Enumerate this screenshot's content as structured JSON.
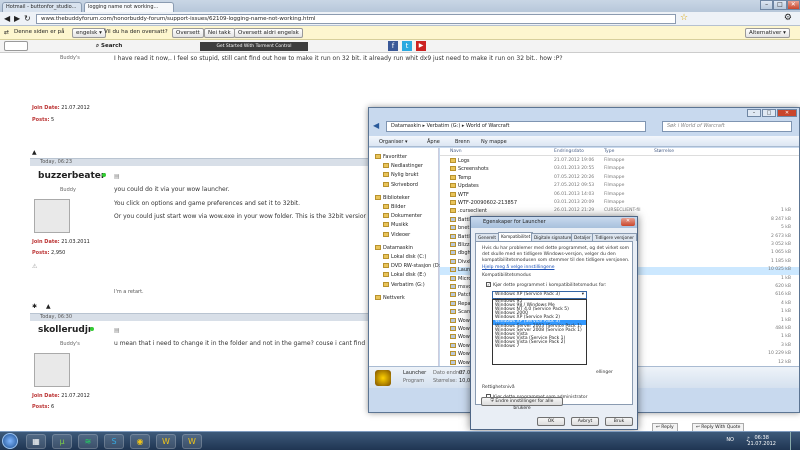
{
  "browser": {
    "tabs": [
      "Hotmail - buttonfor_studio...",
      "logging name not working..."
    ],
    "url": "www.thebuddyforum.com/honorbuddy-forum/support-issues/62109-logging-name-not-working.html",
    "translate": {
      "prefix": "Denne siden er på",
      "from_lang": "engelsk",
      "question": "Vil du ha den oversatt?",
      "translate_btn": "Oversett",
      "no_btn": "Nei takk",
      "never_btn": "Oversett aldri engelsk",
      "options_btn": "Alternativer"
    },
    "search_btn": "Search",
    "toolbar_title": "Get Started With Torment Control"
  },
  "forum": {
    "post1": {
      "role": "Buddy's",
      "text": "I have read it now,. I feel so stupid, still cant find out how to make it run on 32 bit. it already run whit dx9 just need to make it run on 32 bit.. how :P?",
      "join_label": "Join Date:",
      "join_date": "21.07.2012",
      "posts_label": "Posts:",
      "posts": "5"
    },
    "post2": {
      "date": "Today, 06:23",
      "user": "buzzerbeater",
      "role": "Buddy",
      "line1": "you could do it via your wow launcher.",
      "line2": "You click on options and game preferences and set it to 32bit.",
      "line3": "Or you could just start wow via wow.exe in your wow folder. This is the 32bit version. The",
      "sig": "I'm a retart.",
      "join_label": "Join Date:",
      "join_date": "21.03.2011",
      "posts_label": "Posts:",
      "posts": "2,950"
    },
    "post3": {
      "date": "Today, 06:30",
      "user": "skollerudjr",
      "role": "Buddy's",
      "line1": "u mean that i need to change it in the folder and not in the game? couse i cant find 32bit a",
      "join_label": "Join Date:",
      "join_date": "21.07.2012",
      "posts_label": "Posts:",
      "posts": "6",
      "reply": "Reply",
      "reply_quote": "Reply With Quote"
    }
  },
  "explorer": {
    "path": [
      "Datamaskin",
      "Verbatim (G:)",
      "World of Warcraft"
    ],
    "search_placeholder": "Søk i World of Warcraft",
    "cmd": {
      "organize": "Organiser",
      "open": "Åpne",
      "burn": "Brenn",
      "new_folder": "Ny mappe"
    },
    "columns": {
      "name": "Navn",
      "date": "Endringsdato",
      "type": "Type",
      "size": "Størrelse"
    },
    "nav": [
      {
        "label": "Favoritter",
        "indent": 0
      },
      {
        "label": "Nedlastinger",
        "indent": 1
      },
      {
        "label": "Nylig brukt",
        "indent": 1
      },
      {
        "label": "Skrivebord",
        "indent": 1
      },
      {
        "label": "Biblioteker",
        "indent": 0
      },
      {
        "label": "Bilder",
        "indent": 1
      },
      {
        "label": "Dokumenter",
        "indent": 1
      },
      {
        "label": "Musikk",
        "indent": 1
      },
      {
        "label": "Videoer",
        "indent": 1
      },
      {
        "label": "Datamaskin",
        "indent": 0
      },
      {
        "label": "Lokal disk (C:)",
        "indent": 1
      },
      {
        "label": "DVD RW-stasjon (D:)",
        "indent": 1
      },
      {
        "label": "Lokal disk (E:)",
        "indent": 1
      },
      {
        "label": "Verbatim (G:)",
        "indent": 1
      },
      {
        "label": "Nettverk",
        "indent": 0
      }
    ],
    "files": [
      {
        "name": "Logs",
        "date": "21.07.2012 19:06",
        "type": "Filmappe",
        "size": ""
      },
      {
        "name": "Screenshots",
        "date": "03.01.2013 20:55",
        "type": "Filmappe",
        "size": ""
      },
      {
        "name": "Temp",
        "date": "07.05.2012 20:26",
        "type": "Filmappe",
        "size": ""
      },
      {
        "name": "Updates",
        "date": "27.05.2012 09:53",
        "type": "Filmappe",
        "size": ""
      },
      {
        "name": "WTF",
        "date": "06.01.2013 14:03",
        "type": "Filmappe",
        "size": ""
      },
      {
        "name": "WTF-20090602-213857",
        "date": "03.01.2013 20:09",
        "type": "Filmappe",
        "size": ""
      },
      {
        "name": ".curseclient",
        "date": "26.01.2012 21:29",
        "type": "CURSECLIENT-fil",
        "size": "1 kB"
      },
      {
        "name": "Battle.net.dll",
        "date": "",
        "type": "",
        "size": "8 247 kB"
      },
      {
        "name": "bnet.gdb",
        "date": "",
        "type": "",
        "size": "5 kB"
      },
      {
        "name": "Battle.net.mpq",
        "date": "",
        "type": "",
        "size": "2 673 kB"
      },
      {
        "name": "Blizzard Launcher",
        "date": "",
        "type": "",
        "size": "3 052 kB"
      },
      {
        "name": "dbghelp.dll",
        "date": "",
        "type": "",
        "size": "1 065 kB"
      },
      {
        "name": "DivxDecoder.dll",
        "date": "",
        "type": "",
        "size": "1 185 kB"
      },
      {
        "name": "Launcher",
        "date": "",
        "type": "",
        "size": "10 025 kB"
      },
      {
        "name": "Microsoft.VC80.CRT",
        "date": "",
        "type": "",
        "size": "1 kB"
      },
      {
        "name": "msvcr80.dll",
        "date": "",
        "type": "",
        "size": "620 kB"
      },
      {
        "name": "Patch",
        "date": "",
        "type": "",
        "size": "616 kB"
      },
      {
        "name": "Repair",
        "date": "",
        "type": "",
        "size": "4 kB"
      },
      {
        "name": "Scan.dll",
        "date": "",
        "type": "",
        "size": "1 kB"
      },
      {
        "name": "Wow",
        "date": "",
        "type": "",
        "size": "1 kB"
      },
      {
        "name": "Wow",
        "date": "",
        "type": "",
        "size": "484 kB"
      },
      {
        "name": "Wow-64",
        "date": "",
        "type": "",
        "size": "1 kB"
      },
      {
        "name": "Wow",
        "date": "",
        "type": "",
        "size": "3 kB"
      },
      {
        "name": "Wow",
        "date": "",
        "type": "",
        "size": "10 229 kB"
      },
      {
        "name": "WowError",
        "date": "",
        "type": "",
        "size": "12 kB"
      }
    ],
    "details": {
      "name": "Launcher",
      "type": "Program",
      "date_label": "Dato endret:",
      "date": "07.05",
      "size_label": "Størrelse:",
      "size": "10,0 M"
    }
  },
  "dialog": {
    "title": "Egenskaper for Launcher",
    "tabs": [
      "Generelt",
      "Kompatibilitet",
      "Digitale signaturer",
      "Detaljer",
      "Tidligere versjoner"
    ],
    "intro1": "Hvis du har problemer med dette programmet, og det virket som",
    "intro2": "det skulle med en tidligere Windows-versjon, velger du den",
    "intro3": "kompatibilitetsmodusen som stemmer til den tidligere versjonen.",
    "help_link": "Hjelp meg å velge innstillingene",
    "compat_group": "Kompatibilitetsmodus",
    "compat_check": "Kjør dette programmet i kompatibilitetsmodus for:",
    "selected_os": "Windows XP (Service Pack 3)",
    "os_options": [
      "Windows 95",
      "Windows 98 / Windows Me",
      "Windows NT 4.0 (Service Pack 5)",
      "Windows 2000",
      "Windows XP (Service Pack 2)",
      "Windows XP (Service Pack 3)",
      "Windows Server 2003 (Service Pack 1)",
      "Windows Server 2008 (Service Pack 1)",
      "Windows Vista",
      "Windows Vista (Service Pack 1)",
      "Windows Vista (Service Pack 2)",
      "Windows 7"
    ],
    "selected_index": 5,
    "settings_fragment": "ellinger",
    "priv_group": "Rettighetsnivå",
    "admin_check": "Kjør dette programmet som administrator",
    "all_users_btn": "Endre innstillinger for alle brukere",
    "ok": "OK",
    "cancel": "Avbryt",
    "apply": "Bruk"
  },
  "taskbar": {
    "lang": "NO",
    "time": "06:38",
    "date": "21.07.2012"
  }
}
